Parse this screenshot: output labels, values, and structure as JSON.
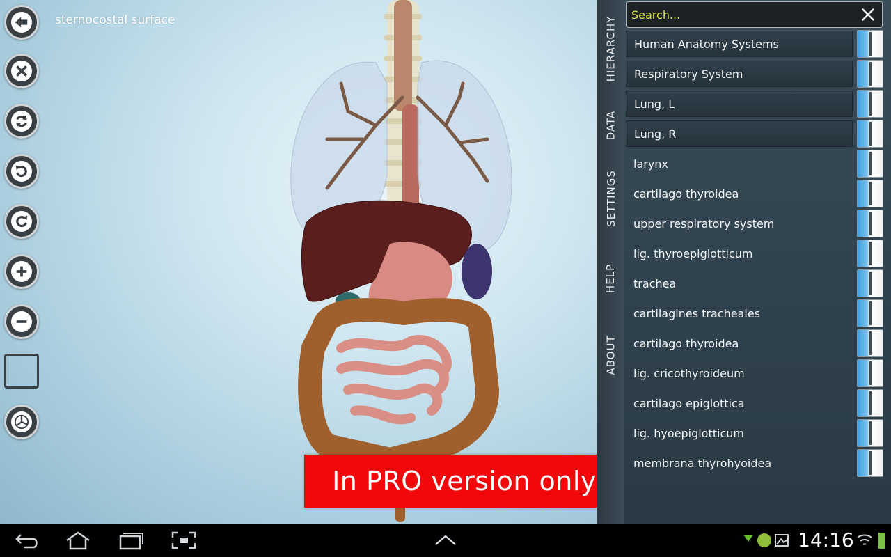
{
  "viewport": {
    "title": "sternocostal surface",
    "banner": "In PRO version only"
  },
  "toolbar": {
    "buttons": [
      {
        "name": "back-button",
        "icon": "arrow-left-icon"
      },
      {
        "name": "close-button",
        "icon": "close-icon"
      },
      {
        "name": "reset-view-button",
        "icon": "refresh-icon"
      },
      {
        "name": "rotate-left-button",
        "icon": "rotate-ccw-icon"
      },
      {
        "name": "rotate-right-button",
        "icon": "rotate-cw-icon"
      },
      {
        "name": "zoom-in-button",
        "icon": "plus-icon"
      },
      {
        "name": "zoom-out-button",
        "icon": "minus-icon"
      },
      {
        "name": "select-box-button",
        "icon": "square-icon"
      },
      {
        "name": "view-mode-button",
        "icon": "pie-icon"
      }
    ]
  },
  "tabs": [
    "HIERARCHY",
    "DATA",
    "SETTINGS",
    "HELP",
    "ABOUT"
  ],
  "search": {
    "placeholder": "Search..."
  },
  "hierarchy": {
    "headers": [
      "Human Anatomy Systems",
      "Respiratory System",
      "Lung, L",
      "Lung, R"
    ],
    "items": [
      "larynx",
      "cartilago thyroidea",
      "upper respiratory system",
      "lig. thyroepiglotticum",
      "trachea",
      "cartilagines tracheales",
      "cartilago thyroidea",
      "lig. cricothyroideum",
      "cartilago epiglottica",
      "lig. hyoepiglotticum",
      "membrana thyrohyoidea"
    ]
  },
  "status": {
    "time": "14:16"
  },
  "colors": {
    "banner": "#f2080a",
    "search_text": "#d8e04a",
    "toggle_on": "#3ea0e0"
  }
}
